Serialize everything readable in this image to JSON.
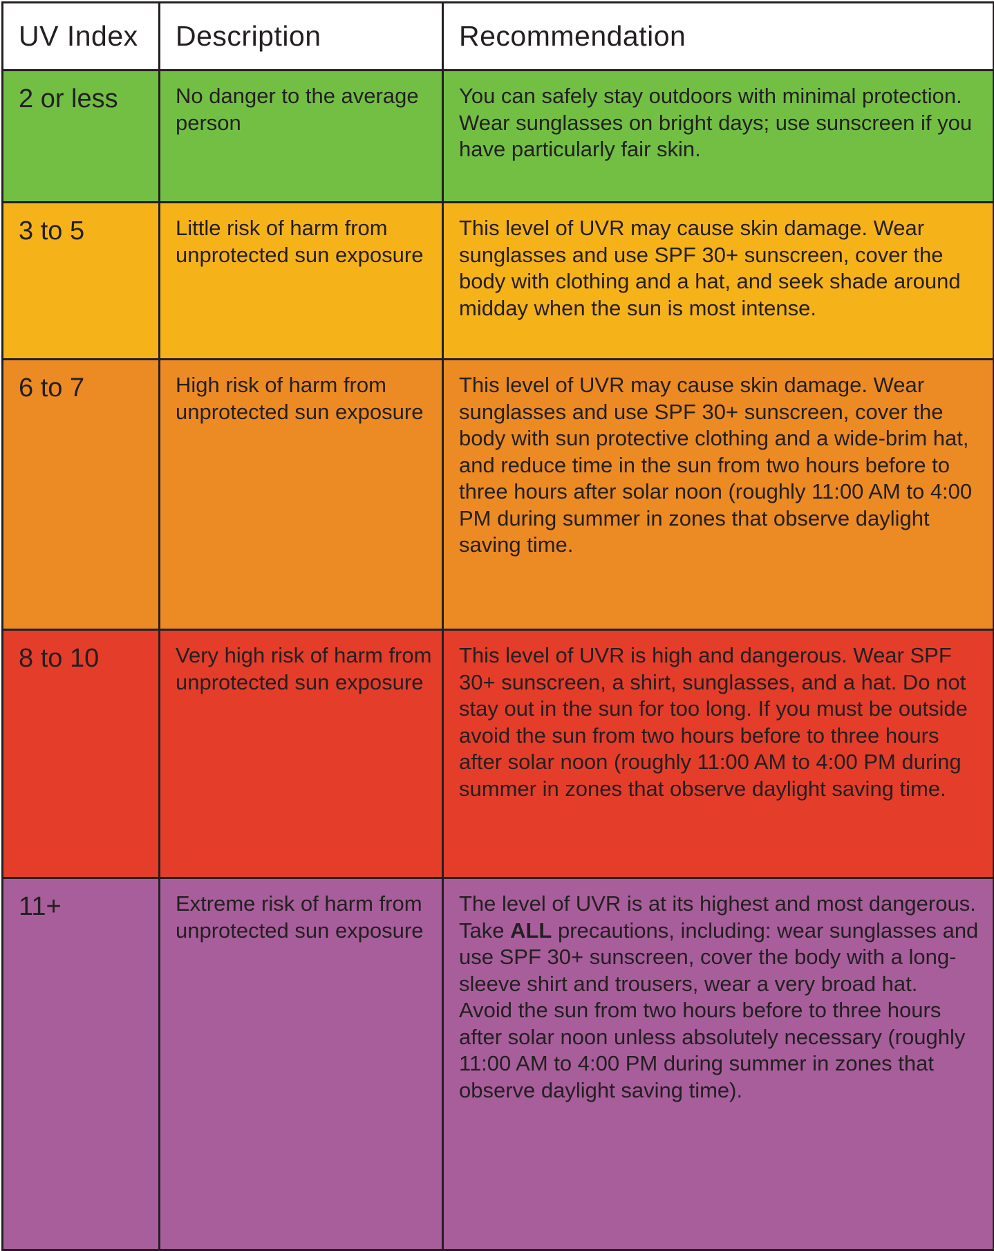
{
  "table": {
    "headers": [
      "UV Index",
      "Description",
      "Recommendation"
    ],
    "rows": [
      {
        "color": "#72bf44",
        "uv_index": "2 or less",
        "description": "No danger to the average person",
        "recommendation": "You can safely stay outdoors with minimal protection. Wear sunglasses on bright days; use sunscreen if you have particularly fair skin."
      },
      {
        "color": "#f6b219",
        "uv_index": "3 to 5",
        "description": "Little risk of harm from unprotected sun exposure",
        "recommendation": "This level of UVR may cause skin damage. Wear sunglasses and use SPF 30+ sunscreen, cover the body with clothing and a hat, and seek shade around midday when the sun is most intense."
      },
      {
        "color": "#ec8a23",
        "uv_index": "6 to 7",
        "description": "High risk of harm from unprotected sun exposure",
        "recommendation": "This level of UVR may cause skin damage. Wear sunglasses and use SPF 30+ sunscreen, cover the body with sun protective clothing and a wide-brim hat, and reduce time in the sun from two hours before to three hours after solar noon (roughly 11:00 AM to 4:00 PM during summer in zones that observe daylight saving time."
      },
      {
        "color": "#e43d2a",
        "uv_index": "8 to 10",
        "description": "Very high risk of harm from unprotected sun exposure",
        "recommendation": "This level of UVR is high and dangerous. Wear SPF 30+ sunscreen, a shirt, sunglasses, and a hat. Do not stay out in the sun for too long. If you must be outside avoid the sun from two hours before to three hours after solar noon (roughly 11:00 AM to 4:00 PM during summer in zones that observe daylight saving time."
      },
      {
        "color": "#a85e9b",
        "uv_index": "11+",
        "description": "Extreme risk of harm from unprotected sun exposure",
        "recommendation_pre": "The level of UVR is at its highest and most dangerous. Take ",
        "recommendation_bold": "ALL",
        "recommendation_post": " precautions, including: wear sunglasses and use SPF 30+ sunscreen, cover the body with a long-sleeve shirt and trousers, wear a very broad hat.",
        "recommendation_extra": "Avoid the sun from two hours before to three hours after solar noon unless absolutely necessary (roughly 11:00 AM to 4:00 PM during summer in zones that observe daylight saving time)."
      }
    ]
  }
}
